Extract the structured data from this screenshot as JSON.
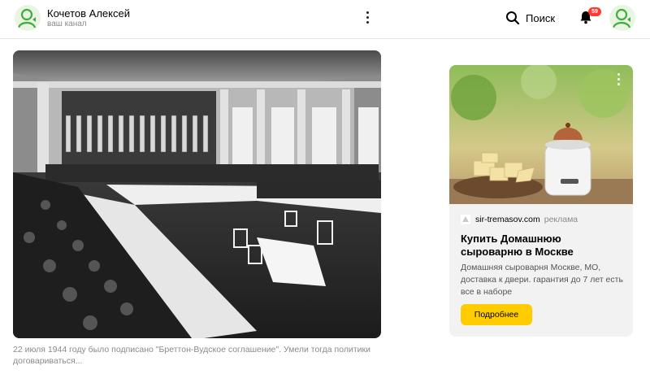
{
  "header": {
    "channel_name": "Кочетов Алексей",
    "channel_subtitle": "ваш канал",
    "search_label": "Поиск",
    "notification_count": "59",
    "icons": {
      "avatar": "avatar-person-icon",
      "more": "more-vertical-icon",
      "search": "search-icon",
      "bell": "bell-icon"
    }
  },
  "post": {
    "caption": "22 июля 1944 году было подписано \"Бреттон-Вудское соглашение\". Умели тогда политики договариваться..."
  },
  "ad": {
    "domain": "sir-tremasov.com",
    "label": "реклама",
    "title": "Купить Домашнюю сыроварню в Москве",
    "description": "Домашняя сыроварня Москве, МО, доставка к двери. гарантия до 7 лет есть все в наборе",
    "button_label": "Подробнее"
  },
  "colors": {
    "accent_button": "#ffcc00",
    "badge": "#ff3b30",
    "avatar_green": "#3fae3a"
  }
}
